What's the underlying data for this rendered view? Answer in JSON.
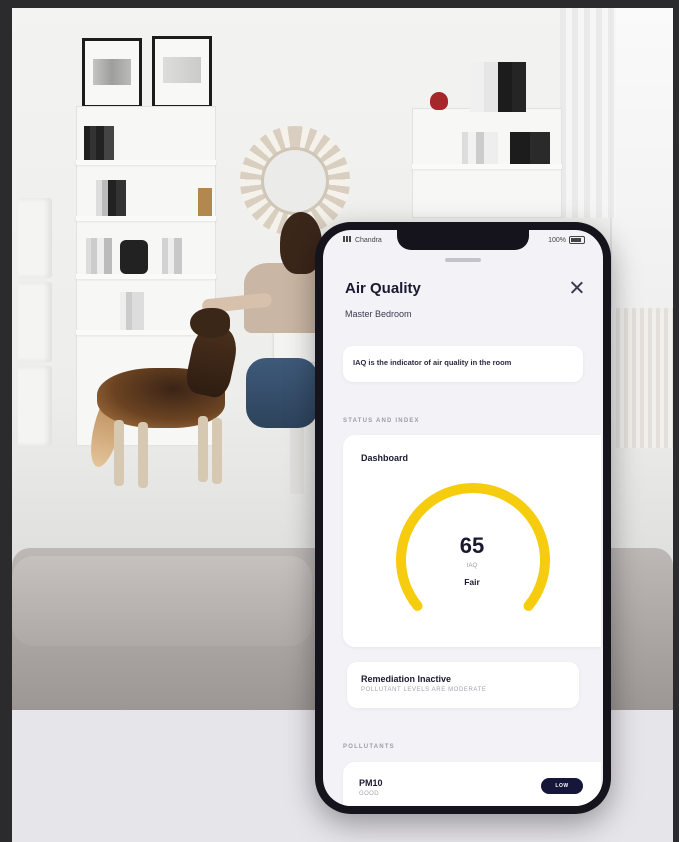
{
  "status_bar": {
    "carrier": "Chandra",
    "battery_pct": "100%"
  },
  "header": {
    "title": "Air Quality",
    "subtitle": "Master Bedroom"
  },
  "info": {
    "text": "IAQ is the indicator of air quality in the room"
  },
  "sections": {
    "status_label": "STATUS AND INDEX",
    "pollutants_label": "POLLUTANTS"
  },
  "dashboard": {
    "title": "Dashboard",
    "value": "65",
    "unit": "IAQ",
    "rating": "Fair",
    "gauge_color": "#F6CC0E",
    "gauge_fraction": 0.72
  },
  "remediation": {
    "title": "Remediation Inactive",
    "subtitle": "POLLUTANT LEVELS ARE MODERATE"
  },
  "pollutants": [
    {
      "name": "PM10",
      "sublabel": "GOOD",
      "badge": "LOW"
    }
  ],
  "icons": {
    "close": "close-icon"
  }
}
